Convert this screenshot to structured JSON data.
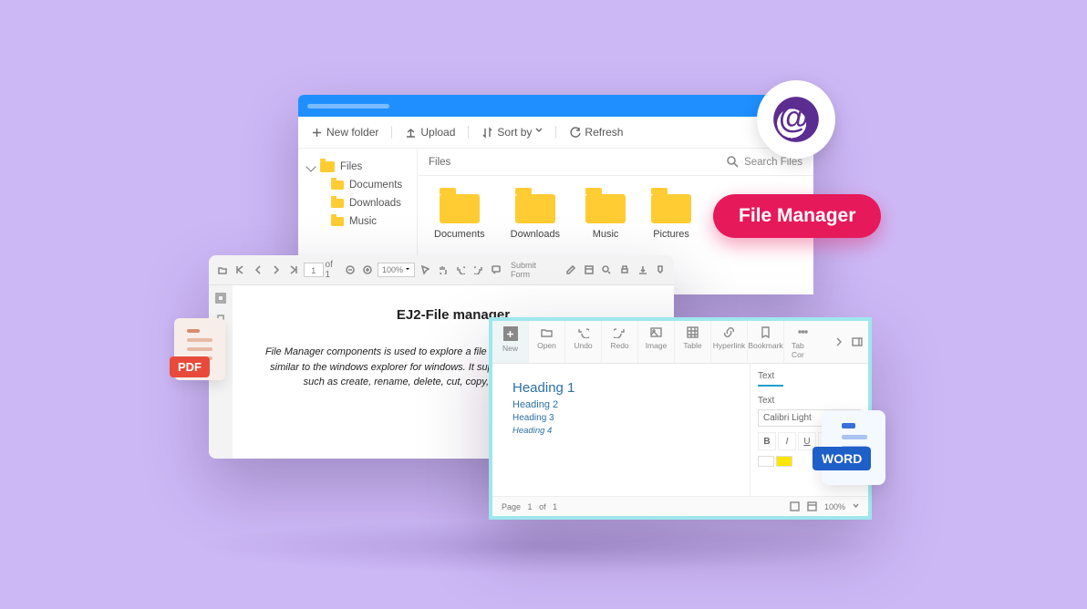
{
  "file_manager": {
    "toolbar": {
      "new_folder": "New folder",
      "upload": "Upload",
      "sort_by": "Sort by",
      "refresh": "Refresh"
    },
    "tree": {
      "root": "Files",
      "children": [
        "Documents",
        "Downloads",
        "Music"
      ]
    },
    "breadcrumb": "Files",
    "search_placeholder": "Search Files",
    "items": [
      "Documents",
      "Downloads",
      "Music",
      "Pictures"
    ]
  },
  "pill_label": "File Manager",
  "pdf_viewer": {
    "page_current": "1",
    "page_of_label": "of 1",
    "zoom": "100%",
    "submit_label": "Submit Form",
    "doc_title": "EJ2-File manager",
    "doc_body": "File Manager components is used to explore a file system through a web application, similar to the windows explorer for windows. It supports all the basic file operations such as create, rename, delete, cut, copy, paste, upload, download."
  },
  "pdf_badge": "PDF",
  "word_editor": {
    "ribbon": [
      "New",
      "Open",
      "Undo",
      "Redo",
      "Image",
      "Table",
      "Hyperlink",
      "Bookmark",
      "Tab Cor"
    ],
    "headings": {
      "h1": "Heading 1",
      "h2": "Heading 2",
      "h3": "Heading 3",
      "h4": "Heading 4"
    },
    "panel": {
      "tab": "Text",
      "section": "Text",
      "font": "Calibri Light"
    },
    "status": {
      "page_label": "Page",
      "current": "1",
      "of": "of",
      "total": "1",
      "zoom": "100%"
    }
  },
  "word_badge": "WORD"
}
